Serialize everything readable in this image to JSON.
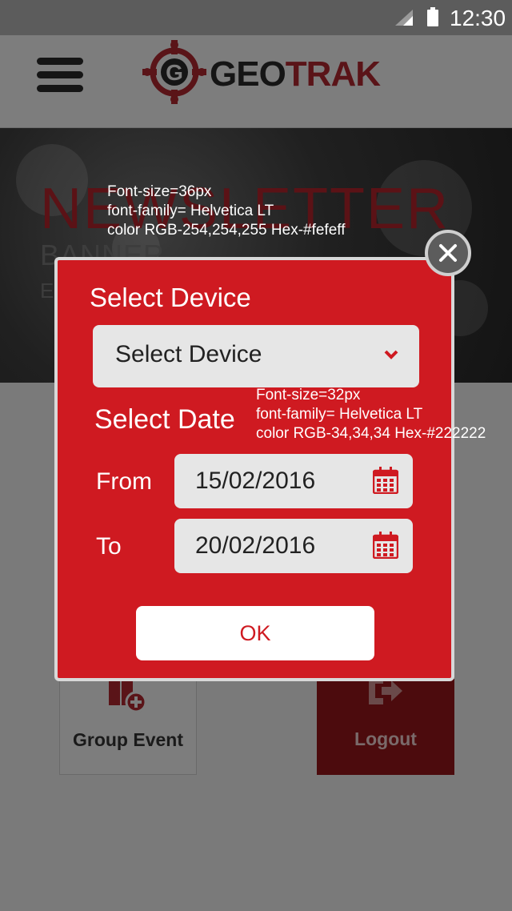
{
  "status_bar": {
    "time": "12:30"
  },
  "header": {
    "logo_geo": "GEO",
    "logo_trak": "TRAK",
    "logo_letter": "G"
  },
  "banner": {
    "title": "NEWSLETTER",
    "subtitle": "BANNER",
    "line2": "E                                                    R"
  },
  "annotations": {
    "a1": [
      "Font-size=36px",
      "font-family= Helvetica LT",
      "color RGB-254,254,255 Hex-#fefeff"
    ],
    "a2": [
      "Font-size=32px",
      "font-family= Helvetica LT",
      "color RGB-34,34,34 Hex-#222222"
    ]
  },
  "tiles": {
    "group_event": "Group Event",
    "logout": "Logout"
  },
  "modal": {
    "device_label": "Select Device",
    "device_value": "Select Device",
    "date_label": "Select Date",
    "from_label": "From",
    "from_value": "15/02/2016",
    "to_label": "To",
    "to_value": "20/02/2016",
    "ok_label": "OK",
    "close_label": "×"
  },
  "colors": {
    "modal_red": "#cf1a21",
    "field_bg": "#e6e6e6",
    "text_dark": "#222222"
  }
}
